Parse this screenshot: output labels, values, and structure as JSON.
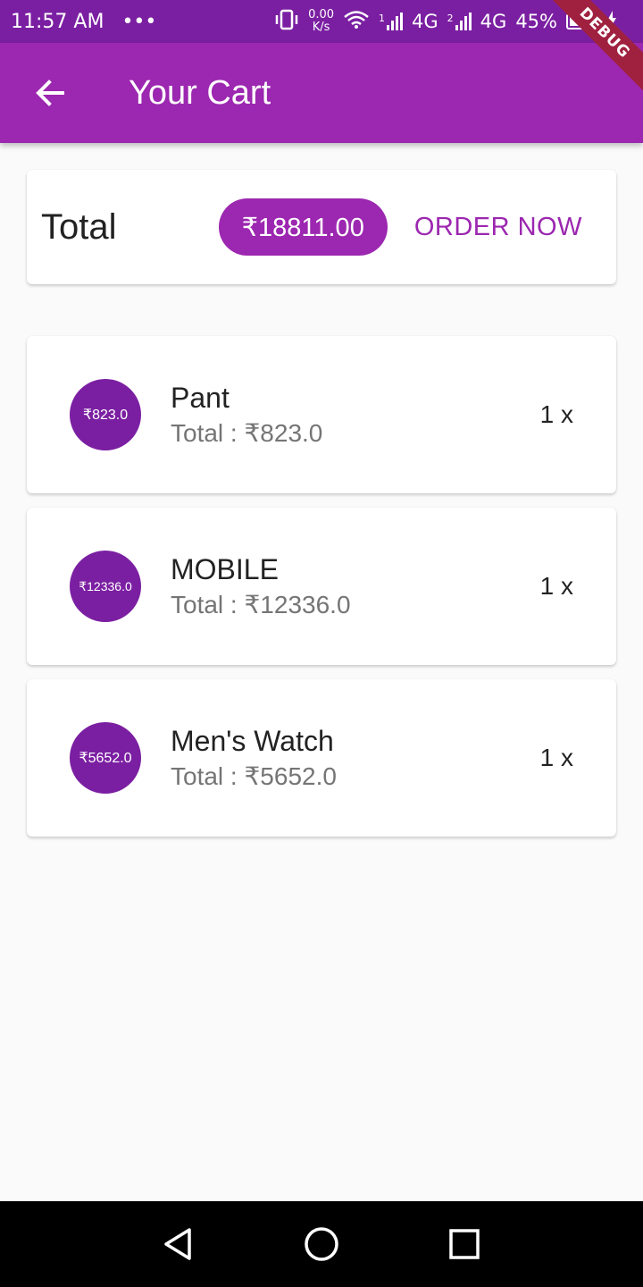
{
  "status_bar": {
    "time": "11:57 AM",
    "dots": "•••",
    "speed_value": "0.00",
    "speed_unit": "K/s",
    "network1": "4G",
    "network2": "4G",
    "battery": "45%",
    "sim1": "1",
    "sim2": "2"
  },
  "debug_banner": "DEBUG",
  "app_bar": {
    "back_icon": "arrow-back-icon",
    "title": "Your Cart"
  },
  "summary": {
    "label": "Total",
    "amount": "₹18811.00",
    "order_label": "ORDER NOW"
  },
  "items": [
    {
      "avatar": "₹823.0",
      "name": "Pant",
      "subtitle": "Total : ₹823.0",
      "quantity": "1 x"
    },
    {
      "avatar": "₹12336.0",
      "name": "MOBILE",
      "subtitle": "Total : ₹12336.0",
      "quantity": "1 x"
    },
    {
      "avatar": "₹5652.0",
      "name": "Men's Watch",
      "subtitle": "Total : ₹5652.0",
      "quantity": "1 x"
    }
  ],
  "colors": {
    "primary": "#9c27b0",
    "primary_dark": "#7b1fa2",
    "background": "#fafafa"
  }
}
